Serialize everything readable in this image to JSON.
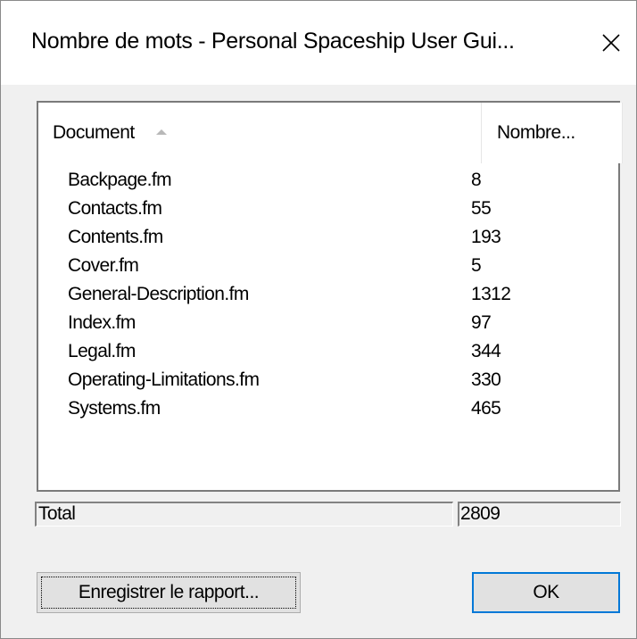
{
  "window": {
    "title": "Nombre de mots - Personal Spaceship User Gui..."
  },
  "icons": {
    "close": "close-icon",
    "sort": "sort-ascending-icon"
  },
  "table": {
    "columns": [
      "Document",
      "Nombre..."
    ],
    "sorted_column": "Document",
    "sort_direction": "ascending",
    "rows": [
      {
        "document": "Backpage.fm",
        "count": "8"
      },
      {
        "document": "Contacts.fm",
        "count": "55"
      },
      {
        "document": "Contents.fm",
        "count": "193"
      },
      {
        "document": "Cover.fm",
        "count": "5"
      },
      {
        "document": "General-Description.fm",
        "count": "1312"
      },
      {
        "document": "Index.fm",
        "count": "97"
      },
      {
        "document": "Legal.fm",
        "count": "344"
      },
      {
        "document": "Operating-Limitations.fm",
        "count": "330"
      },
      {
        "document": "Systems.fm",
        "count": "465"
      }
    ]
  },
  "total": {
    "label": "Total",
    "value": "2809"
  },
  "buttons": {
    "save_report": "Enregistrer le rapport...",
    "ok": "OK"
  },
  "colors": {
    "accent": "#0078d7",
    "dialog_bg": "#f0f0f0",
    "button_bg": "#e1e1e1"
  }
}
